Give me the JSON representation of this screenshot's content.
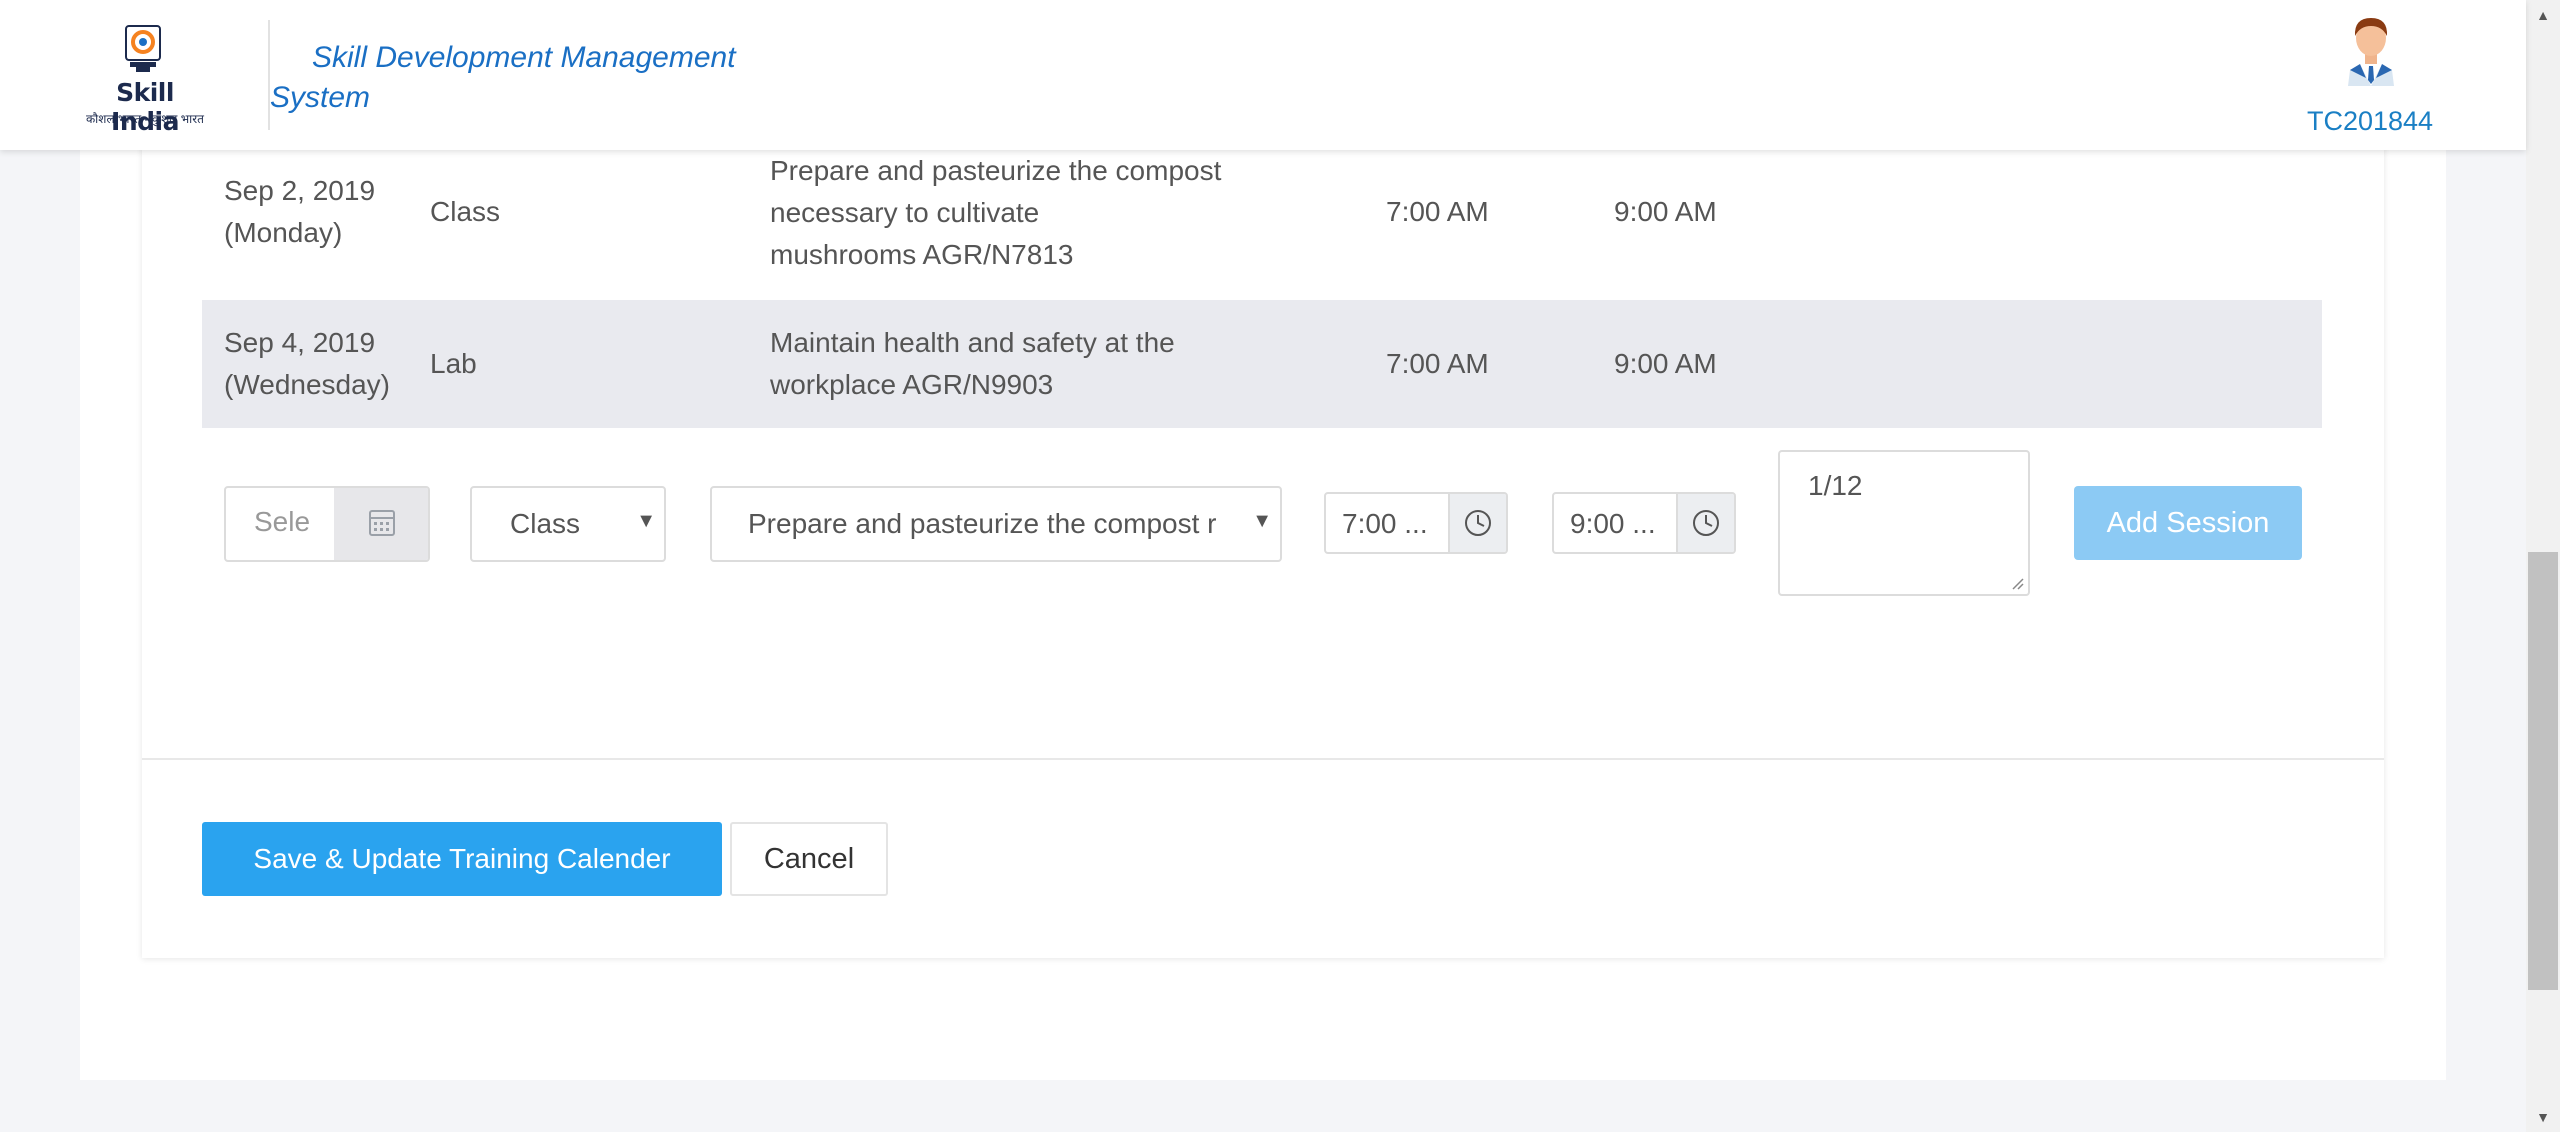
{
  "header": {
    "logo_text": "Skill India",
    "logo_subtext": "कौशल भारत - कुशल भारत",
    "app_title_line1": "Skill Development Management",
    "app_title_line2": "System",
    "user_id": "TC201844"
  },
  "sessions": [
    {
      "date": "Sep 2, 2019",
      "day": "(Monday)",
      "type": "Class",
      "topic_lines": [
        "Prepare and pasteurize the compost",
        "necessary to cultivate",
        "mushrooms AGR/N7813"
      ],
      "start": "7:00 AM",
      "end": "9:00 AM"
    },
    {
      "date": "Sep 4, 2019",
      "day": "(Wednesday)",
      "type": "Lab",
      "topic_lines": [
        "Maintain health and safety at the",
        "workplace AGR/N9903"
      ],
      "start": "7:00 AM",
      "end": "9:00 AM"
    }
  ],
  "form": {
    "date_placeholder": "Sele",
    "type_value": "Class",
    "topic_value": "Prepare and pasteurize the compost r",
    "start_time": "7:00 ...",
    "end_time": "9:00 ...",
    "note_value": "1/12",
    "add_session_label": "Add Session"
  },
  "actions": {
    "save_label": "Save & Update Training Calender",
    "cancel_label": "Cancel"
  },
  "icons": {
    "calendar": "calendar-icon",
    "clock": "clock-icon",
    "caret": "caret-down-icon"
  },
  "colors": {
    "brand_blue": "#1a6fc4",
    "primary_button": "#2aa3ef",
    "disabled_button": "#8ccaf4",
    "alt_row": "#e9eaef"
  }
}
